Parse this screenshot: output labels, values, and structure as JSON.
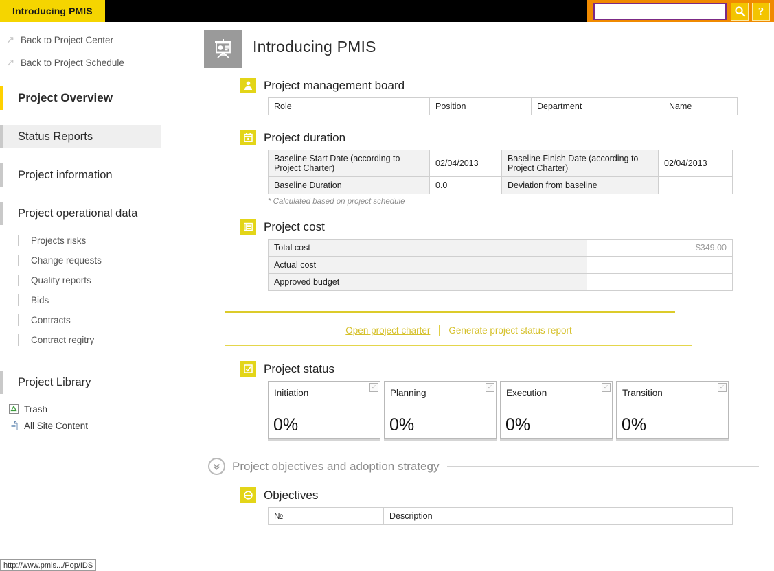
{
  "topbar": {
    "site_tab": "Introducing PMIS",
    "search_value": "",
    "search_placeholder": "",
    "search_icon": "magnifier-icon",
    "help_label": "?"
  },
  "sidebar": {
    "back_links": [
      {
        "label": "Back to Project Center",
        "icon": "arrow-up-right-icon"
      },
      {
        "label": "Back to Project Schedule",
        "icon": "arrow-up-right-icon"
      }
    ],
    "sections": [
      {
        "label": "Project Overview",
        "state": "active"
      },
      {
        "label": "Status Reports",
        "state": "highlight"
      },
      {
        "label": "Project information",
        "state": "normal"
      },
      {
        "label": "Project operational data",
        "state": "normal"
      }
    ],
    "sub_items": [
      {
        "label": "Projects risks"
      },
      {
        "label": "Change requests"
      },
      {
        "label": "Quality reports"
      },
      {
        "label": "Bids"
      },
      {
        "label": "Contracts"
      },
      {
        "label": "Contract regitry"
      }
    ],
    "library_section": {
      "label": "Project Library",
      "state": "normal"
    },
    "utilities": [
      {
        "label": "Trash",
        "icon": "recycle-bin-icon"
      },
      {
        "label": "All Site Content",
        "icon": "document-icon"
      }
    ]
  },
  "page": {
    "title": "Introducing PMIS",
    "icon": "presentation-board-icon"
  },
  "board": {
    "title": "Project management board",
    "icon": "person-icon",
    "columns": [
      "Role",
      "Position",
      "Department",
      "Name"
    ],
    "rows": []
  },
  "duration": {
    "title": "Project duration",
    "icon": "calendar-icon",
    "rows": [
      {
        "label_a": "Baseline Start Date (according to Project Charter)",
        "value_a": "02/04/2013",
        "label_b": "Baseline Finish Date (according to Project Charter)",
        "value_b": "02/04/2013"
      },
      {
        "label_a": "Baseline Duration",
        "value_a": "0.0",
        "label_b": "Deviation from baseline",
        "value_b": ""
      }
    ],
    "note": "* Calculated based on project schedule"
  },
  "cost": {
    "title": "Project cost",
    "icon": "money-bill-icon",
    "rows": [
      {
        "label": "Total cost",
        "value": "$349.00"
      },
      {
        "label": "Actual cost",
        "value": ""
      },
      {
        "label": "Approved budget",
        "value": ""
      }
    ]
  },
  "actions": {
    "primary_link": "Open project charter",
    "secondary_link": "Generate project status report",
    "accent_color": "#dccb2a"
  },
  "status": {
    "title": "Project status",
    "icon": "checkbox-check-icon",
    "cards": [
      {
        "label": "Initiation",
        "value": "0%",
        "checkbox": "checkbox-icon",
        "check": "✓"
      },
      {
        "label": "Planning",
        "value": "0%",
        "checkbox": "checkbox-icon",
        "check": "✓"
      },
      {
        "label": "Execution",
        "value": "0%",
        "checkbox": "checkbox-icon",
        "check": "✓"
      },
      {
        "label": "Transition",
        "value": "0%",
        "checkbox": "checkbox-icon",
        "check": "✓"
      }
    ]
  },
  "objectives_group": {
    "title": "Project objectives and adoption strategy",
    "icon": "chevron-down-circle-icon"
  },
  "objectives": {
    "title": "Objectives",
    "icon": "target-globe-icon",
    "columns": [
      "№",
      "Description"
    ],
    "rows": []
  },
  "statusbar": {
    "url": "http://www.pmis.../Pop/IDS"
  },
  "colors": {
    "brand_yellow": "#f5d500",
    "section_yellow": "#e3d518",
    "accent_gold": "#dccb2a",
    "search_band_orange": "#f08a00",
    "topbar_black": "#000000"
  }
}
